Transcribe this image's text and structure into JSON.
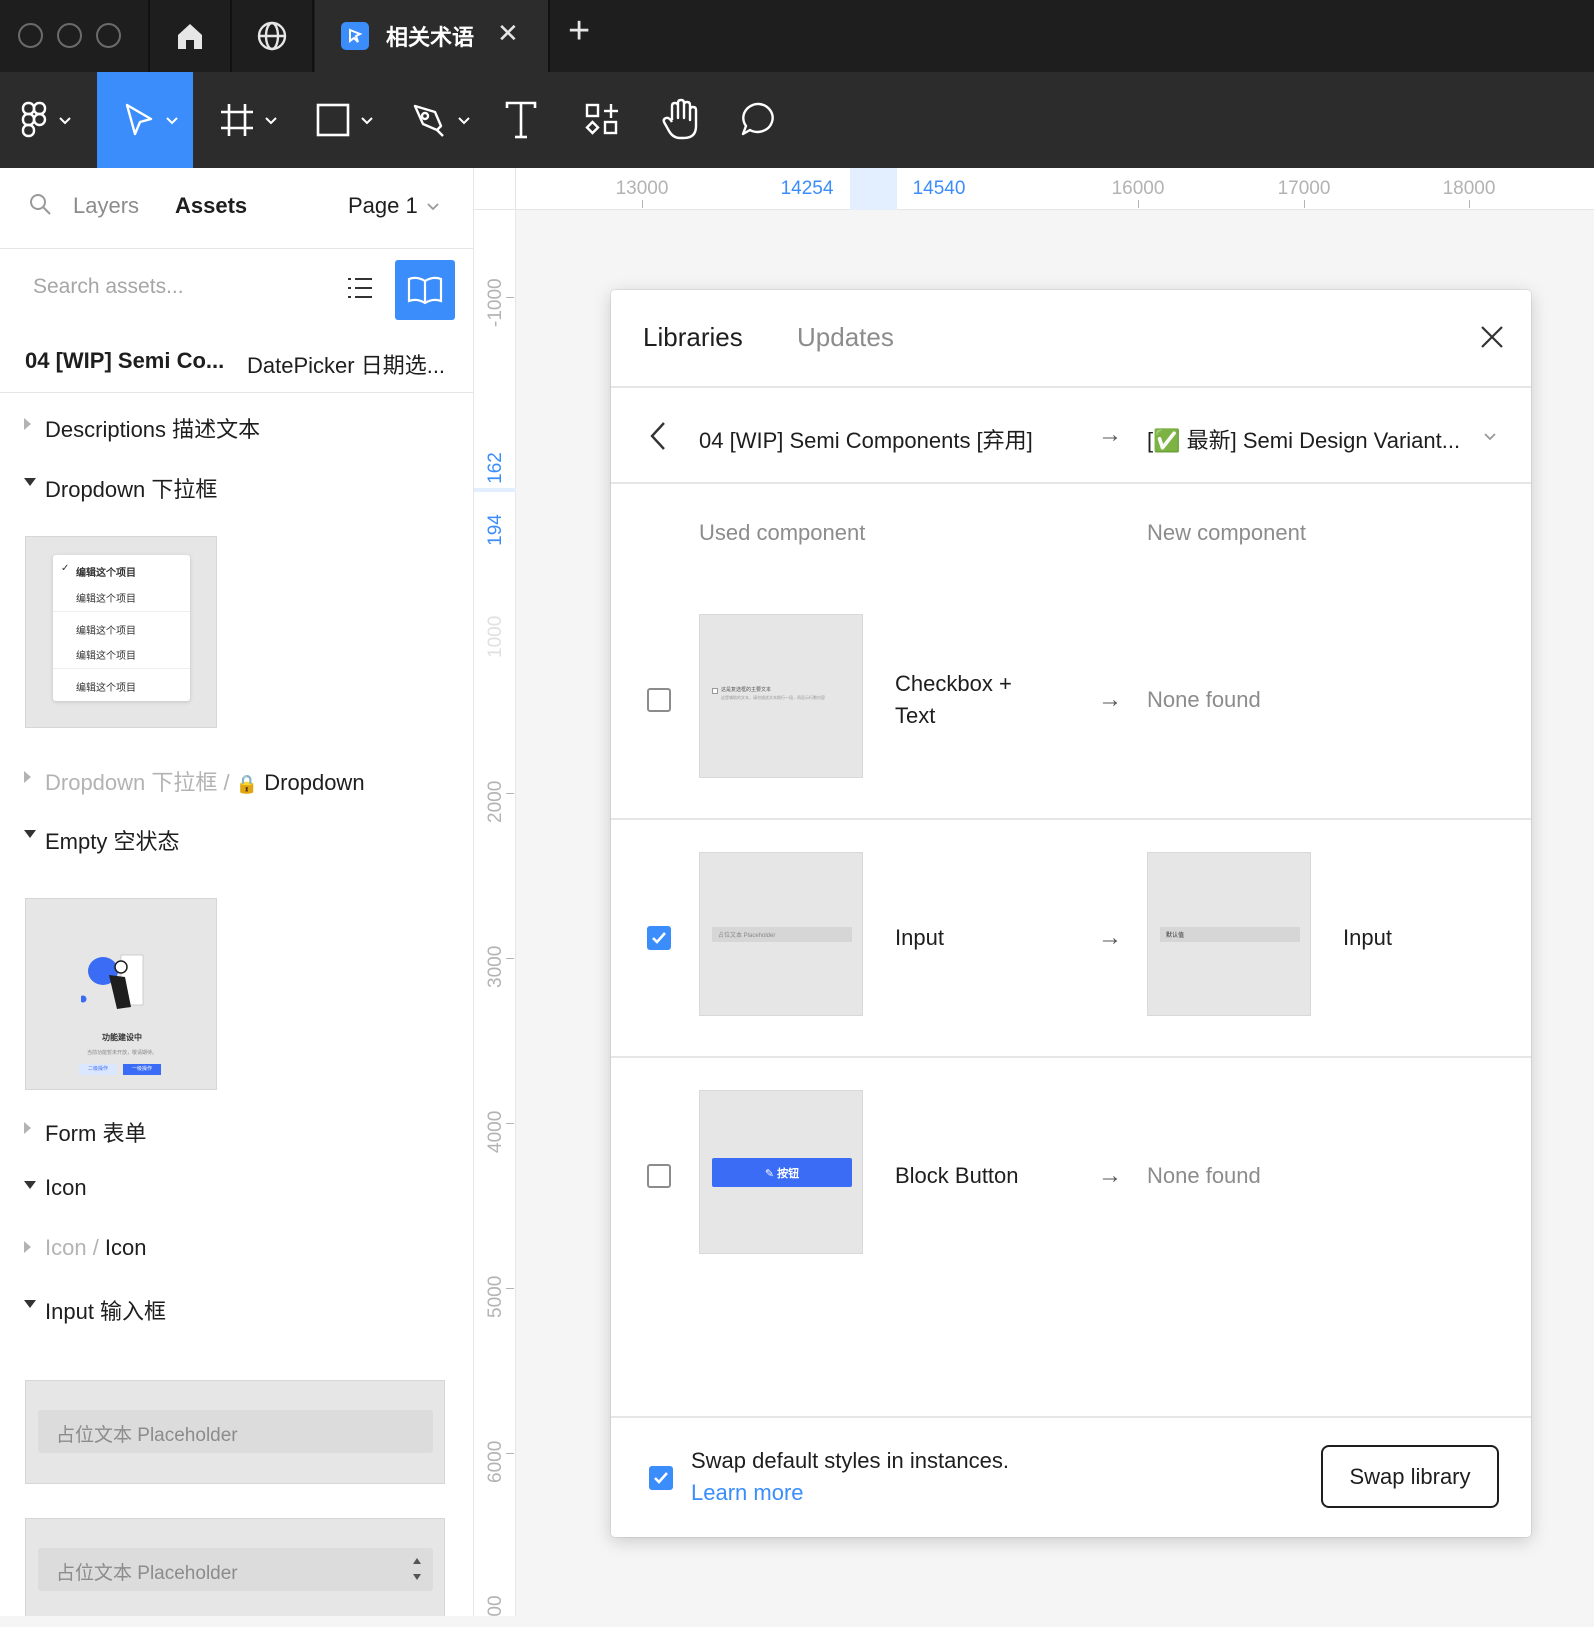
{
  "titlebar": {
    "tab_title": "相关术语",
    "close_glyph": "✕",
    "new_tab_glyph": "+"
  },
  "left_panel": {
    "tab_layers": "Layers",
    "tab_assets": "Assets",
    "page_selector": "Page 1",
    "search_placeholder": "Search assets...",
    "library_name": "04 [WIP] Semi Co...",
    "library_path": "DatePicker 日期选...",
    "sections": [
      {
        "label": "Descriptions 描述文本",
        "expanded": false
      },
      {
        "label": "Dropdown 下拉框",
        "expanded": true
      },
      {
        "label_muted": "Dropdown 下拉框 / ",
        "label": "Dropdown",
        "expanded": false
      },
      {
        "label": "Empty 空状态",
        "expanded": true
      },
      {
        "label": "Form 表单",
        "expanded": false
      },
      {
        "label": "Icon",
        "expanded": true
      },
      {
        "label_muted": "Icon / ",
        "label": "Icon",
        "expanded": false
      },
      {
        "label": "Input 输入框",
        "expanded": true
      }
    ],
    "dropdown_thumb_items": [
      "编辑这个项目",
      "编辑这个项目",
      "编辑这个项目",
      "编辑这个项目",
      "编辑这个项目"
    ],
    "empty_thumb": {
      "title": "功能建设中",
      "desc": "当前功能暂未开放，敬请期待。",
      "btn_secondary": "二级操作",
      "btn_primary": "一级操作"
    },
    "input_placeholder_1": "占位文本 Placeholder",
    "input_placeholder_2": "占位文本 Placeholder"
  },
  "ruler": {
    "top": [
      "13000",
      "14254",
      "14540",
      "16000",
      "17000",
      "18000"
    ],
    "left": [
      "-1000",
      "162",
      "194",
      "1000",
      "2000",
      "3000",
      "4000",
      "5000",
      "6000",
      "00"
    ]
  },
  "dialog": {
    "tab_libraries": "Libraries",
    "tab_updates": "Updates",
    "from_library": "04 [WIP] Semi Components [弃用]",
    "to_library": "[✅ 最新] Semi Design Variant...",
    "col_used": "Used component",
    "col_new": "New component",
    "rows": [
      {
        "name": "Checkbox +\nText",
        "name_line1": "Checkbox +",
        "name_line2": "Text",
        "result": "None found",
        "checked": false,
        "thumb_text": "这是复选框的主要文本",
        "thumb_sub": "这是辅助的文本，请勿描述文本换行一段，再显示行数内容"
      },
      {
        "name": "Input",
        "result_name": "Input",
        "checked": true,
        "thumb_text": "占位文本 Placeholder",
        "new_thumb_text": "默认值"
      },
      {
        "name": "Block Button",
        "result": "None found",
        "checked": false,
        "thumb_text": "按钮"
      }
    ],
    "footer_text": "Swap default styles in instances.",
    "footer_link": "Learn more",
    "footer_checked": true,
    "swap_button": "Swap library"
  },
  "colors": {
    "accent": "#3a8dfa",
    "dark_bg": "#1e1e1e",
    "toolbar_bg": "#2c2c2c"
  }
}
